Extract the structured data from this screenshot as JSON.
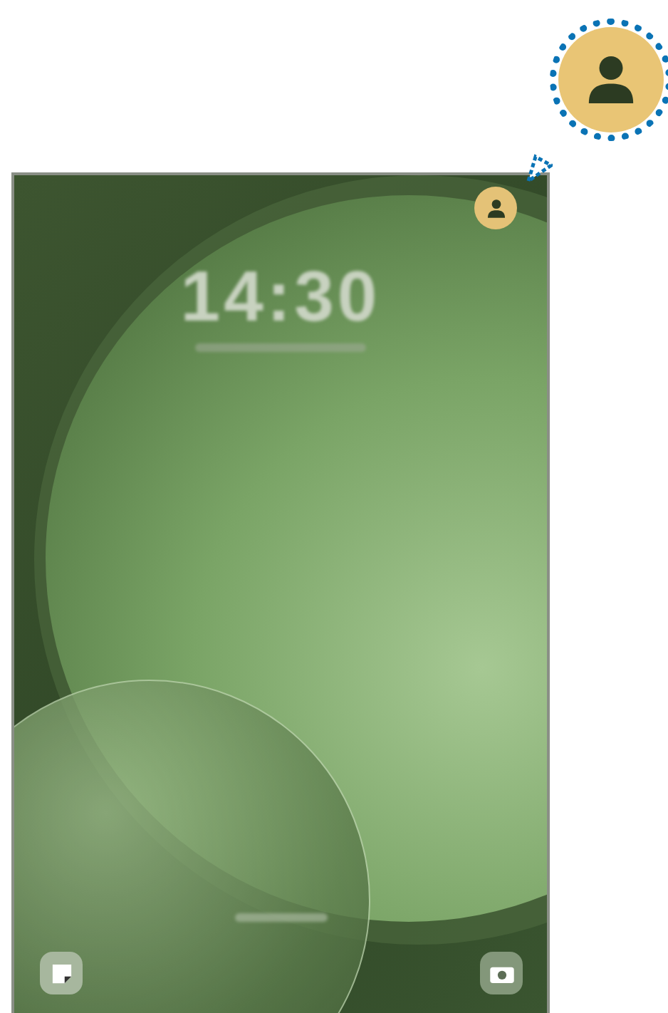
{
  "lock_screen": {
    "time": "14:30"
  }
}
